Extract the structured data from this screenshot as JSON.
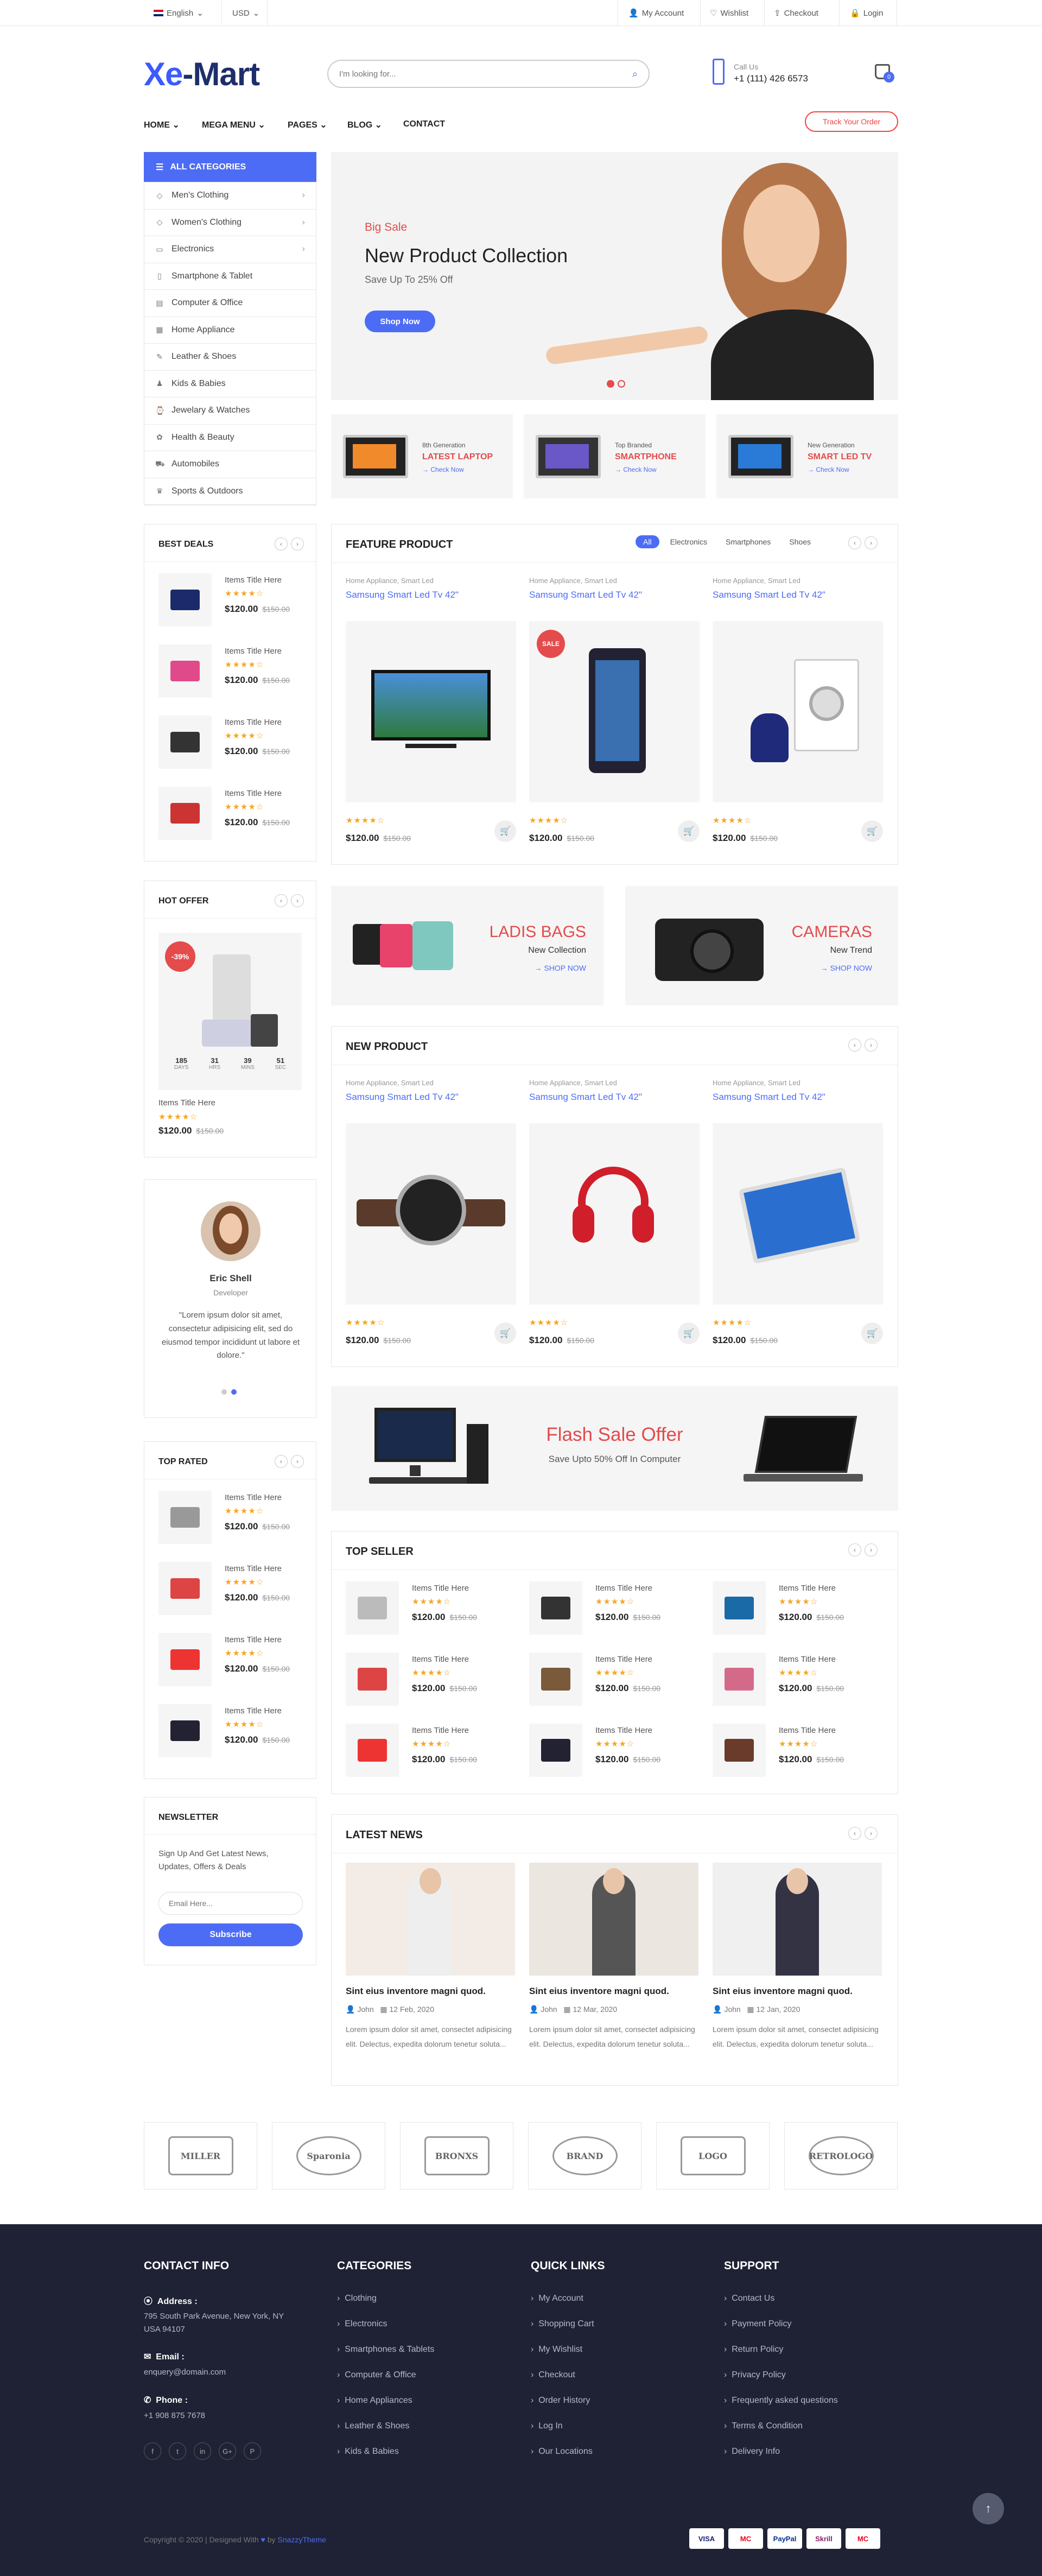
{
  "topbar": {
    "language": "English",
    "currency": "USD",
    "account": "My Account",
    "wishlist": "Wishlist",
    "checkout": "Checkout",
    "login": "Login"
  },
  "header": {
    "logo_a": "Xe",
    "logo_b": "-Mart",
    "search_placeholder": "I'm looking for...",
    "call_label": "Call Us",
    "phone": "+1 (111) 426 6573",
    "cart_count": "0"
  },
  "nav": {
    "items": [
      "HOME",
      "MEGA MENU",
      "PAGES",
      "BLOG",
      "CONTACT"
    ],
    "track": "Track Your Order"
  },
  "categories": {
    "title": "ALL CATEGORIES",
    "items": [
      "Men's Clothing",
      "Women's Clothing",
      "Electronics",
      "Smartphone & Tablet",
      "Computer & Office",
      "Home Appliance",
      "Leather & Shoes",
      "Kids & Babies",
      "Jewelary & Watches",
      "Health & Beauty",
      "Automobiles",
      "Sports & Outdoors"
    ]
  },
  "hero": {
    "tag": "Big Sale",
    "title": "New Product Collection",
    "subtitle": "Save Up To 25% Off",
    "button": "Shop Now"
  },
  "promos": [
    {
      "small": "8th Generation",
      "title": "LATEST LAPTOP",
      "link": "→ Check Now"
    },
    {
      "small": "Top Branded",
      "title": "SMARTPHONE",
      "link": "→ Check Now"
    },
    {
      "small": "New Generation",
      "title": "SMART LED TV",
      "link": "→ Check Now"
    }
  ],
  "best_deals": {
    "title": "BEST DEALS",
    "item": "Items Title Here",
    "price": "$120.00",
    "old": "$150.00"
  },
  "hot_offer": {
    "title": "HOT OFFER",
    "badge": "-39%",
    "days": "185",
    "hrs": "31",
    "mins": "39",
    "sec": "51",
    "days_l": "DAYS",
    "hrs_l": "HRS",
    "mins_l": "MINS",
    "sec_l": "SEC",
    "item": "Items Title Here",
    "price": "$120.00",
    "old": "$150.00"
  },
  "testimonial": {
    "name": "Eric Shell",
    "role": "Developer",
    "quote": "\"Lorem ipsum dolor sit amet, consectetur adipisicing elit, sed do eiusmod tempor incididunt ut labore et dolore.\""
  },
  "top_rated": {
    "title": "TOP RATED"
  },
  "newsletter": {
    "title": "NEWSLETTER",
    "text": "Sign Up And Get Latest News, Updates, Offers & Deals",
    "placeholder": "Email Here...",
    "button": "Subscribe"
  },
  "feature": {
    "title": "FEATURE PRODUCT",
    "tabs": [
      "All",
      "Electronics",
      "Smartphones",
      "Shoes"
    ],
    "cats": "Home Appliance,   Smart Led",
    "name": "Samsung Smart Led Tv 42\"",
    "price": "$120.00",
    "old": "$150.00",
    "sale": "SALE"
  },
  "banners": [
    {
      "title": "LADIS BAGS",
      "sub": "New Collection",
      "link": "→ SHOP NOW"
    },
    {
      "title": "CAMERAS",
      "sub": "New Trend",
      "link": "→ SHOP NOW"
    }
  ],
  "new_product": {
    "title": "NEW PRODUCT"
  },
  "flash": {
    "title": "Flash Sale Offer",
    "sub": "Save Upto 50% Off In Computer"
  },
  "top_seller": {
    "title": "TOP SELLER"
  },
  "news": {
    "title": "LATEST NEWS",
    "posts": [
      {
        "title": "Sint eius inventore magni quod.",
        "author": "John",
        "date": "12 Feb, 2020"
      },
      {
        "title": "Sint eius inventore magni quod.",
        "author": "John",
        "date": "12 Mar, 2020"
      },
      {
        "title": "Sint eius inventore magni quod.",
        "author": "John",
        "date": "12 Jan, 2020"
      }
    ],
    "excerpt": "Lorem ipsum dolor sit amet, consectet adipisicing elit. Delectus, expedita dolorum tenetur soluta..."
  },
  "brands": [
    "MILLER",
    "Sparonia",
    "BRONXS",
    "BRAND",
    "LOGO",
    "RETROLOGO"
  ],
  "footer": {
    "contact_title": "CONTACT INFO",
    "address_label": "Address :",
    "address": "795 South Park Avenue, New York, NY USA 94107",
    "email_label": "Email :",
    "email": "enquery@domain.com",
    "phone_label": "Phone :",
    "phone": "+1 908 875 7678",
    "social": [
      "f",
      "t",
      "in",
      "G+",
      "P"
    ],
    "categories_title": "CATEGORIES",
    "categories": [
      "Clothing",
      "Electronics",
      "Smartphones & Tablets",
      "Computer & Office",
      "Home Appliances",
      "Leather & Shoes",
      "Kids & Babies"
    ],
    "links_title": "QUICK LINKS",
    "links": [
      "My Account",
      "Shopping Cart",
      "My Wishlist",
      "Checkout",
      "Order History",
      "Log In",
      "Our Locations"
    ],
    "support_title": "SUPPORT",
    "support": [
      "Contact Us",
      "Payment Policy",
      "Return Policy",
      "Privacy Policy",
      "Frequently asked questions",
      "Terms & Condition",
      "Delivery Info"
    ],
    "copyright": "Copyright © 2020 | Designed With",
    "by": "by",
    "author": "SnazzyTheme",
    "payments": [
      "VISA",
      "MC",
      "PayPal",
      "Skrill",
      "MC"
    ]
  },
  "colors": {
    "accent": "#4d6cf5",
    "red": "#e44b4b",
    "footer": "#1f2234"
  }
}
